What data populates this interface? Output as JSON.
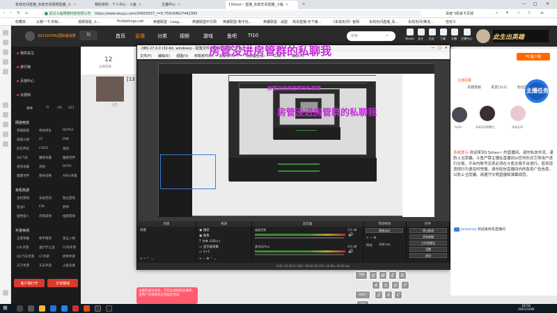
{
  "browser": {
    "tabs": [
      {
        "label": "永劫无间直播_永劫无间视频直播_小"
      },
      {
        "label": "我的资料 - 个人中心 - 斗鱼"
      },
      {
        "label": "主播中心"
      },
      {
        "label": "13shao~ 直播_永劫无间直播_斗鱼"
      }
    ],
    "address_tag": "武汉斗鱼网络科技有限公司",
    "url": "https://www.douyu.com/24655557_r=0.7591946274423​95",
    "right_label": "百度飞机就卡灭掉",
    "bookmarks": [
      "收藏夹",
      "从我一下,你就... ",
      "视频观看_斗...",
      "ProSettings.net",
      "英雄联盟 - Leag...",
      "英雄联盟中文网",
      "英雄联盟-我不玩...",
      "英雄联盟 - 战盟",
      "高清直播-天下第...",
      "《永劫无间》官网",
      "永劫无间直播_永...",
      "永劫无间(推流...",
      "自定义"
    ]
  },
  "douyu": {
    "brand": "2021DOTA2国际邀请赛",
    "nav": [
      "首页",
      "直播",
      "分类",
      "视频",
      "游戏",
      "鱼吧",
      "TI10"
    ],
    "search_placeholder": "搜索",
    "header_right": [
      "Steam",
      "关注",
      "历史",
      "下载",
      "开播",
      "主播中心"
    ],
    "sidebar": {
      "top_items": [
        "我的关注",
        "排行榜",
        "页游中心",
        "云游戏"
      ],
      "tags_row": [
        "赛事",
        "TI",
        "LPL",
        "S11"
      ],
      "section1_head": "网游竞技",
      "section1": [
        "英雄联盟",
        "绝地求生",
        "DOTA2",
        "穿越火线",
        "CF",
        "DNF",
        "炉石传说",
        "CSGO",
        "星际",
        "QQ飞车",
        "魔兽争霸",
        "魔兽世界",
        "星际争霸",
        "其他",
        "DOTA",
        "雷霆世界",
        "使命召唤",
        "APEX英雄"
      ],
      "section2_head": "单机热游",
      "section2": [
        "主机游戏",
        "永劫无间",
        "独立游戏",
        "星战2",
        "FPA",
        "原神",
        "怪物猎人",
        "恐怖游戏",
        "怪兽游戏"
      ],
      "section3_head": "手游休闲",
      "section3": [
        "王者荣耀",
        "和平精英",
        "第五人格",
        "LOL手游",
        "金铲铲之战",
        "COD手游",
        "QQ飞车手游",
        "CF手游",
        "原神手游",
        "天刀手游",
        "天天手游",
        "火影忍者"
      ],
      "btn_client": "客户端打开",
      "btn_share": "分享赚钱"
    },
    "room": {
      "count": "12",
      "count_label": "主播等级",
      "title": "[13",
      "extra_label": "公告"
    },
    "right_panel": {
      "pc_client": "PC客户端",
      "task_badge": "主播任务",
      "tabs": [
        "主播招募",
        "本期贡献",
        "贵宾(212)",
        "粉丝团"
      ],
      "avatars": [
        {
          "name": "tsyku"
        },
        {
          "name": "永劫无间相聚之"
        },
        {
          "name": "永劫无间"
        }
      ],
      "chat_sys_label": "系统提示:",
      "chat_text": "欢迎来到13shao~ 的直播间，请勿私信外流，谨防上当受骗。斗鱼严禁主播在直播间以任何形式引导用户进行交易，平台内账号买卖必须在斗鱼交易平台进行。若发现违规行为请及时举报。请勿轻信直播间内的各类广告信息，以防上当受骗。请遵守文明直播和弹幕规范。",
      "chat_user": "Jackalray",
      "chat_user_msg": "欢迎来到本直播间"
    }
  },
  "obs": {
    "title": "OBS 27.0.0 (32-bit, windows) - 配置文件: 未命名 - 场景: 未命名",
    "menu": [
      "文件(F)",
      "编辑(E)",
      "视图(V)",
      "停靠部件(D)",
      "配置文件(P)",
      "场景集合(S)",
      "工具(T)",
      "帮助(H)"
    ],
    "overlay_big": "房管没进房管群的私聊我",
    "overlay_small": "房管没进房管群的私聊我",
    "docks": [
      "场景",
      "来源",
      "混音器",
      "转场特效",
      "控件"
    ],
    "scene_items": [
      "场景"
    ],
    "sources": [
      "捕捉",
      "图像",
      "文本 (GDI+)",
      "显示器采集",
      "1+1"
    ],
    "mixer": [
      {
        "label": "桌面音频",
        "level": "-3.5 dB"
      },
      {
        "label": "麦克风/Aux",
        "level": "-0.0 dB"
      }
    ],
    "transition": {
      "label": "直接淡出",
      "duration_label": "时长",
      "duration": "300 ms"
    },
    "controls": [
      "停止推流",
      "开始录制",
      "工作室模式",
      "设置",
      "退出"
    ],
    "status": "LIVE: 01:44:11   REC: 00:00:00   CPU: 16.8%, 60.00 fps"
  },
  "keyboard": [
    "TAB",
    "Q",
    "W",
    "E",
    "R",
    "A",
    "S",
    "D",
    "F",
    "SHIFT",
    "Z",
    "X",
    "C",
    "CTRL"
  ],
  "popup": {
    "text": "主播完成任务后，可在此领取粉丝徽章，且用户可领取对应奖励的活动"
  },
  "taskbar": {
    "time": "18:56",
    "date": "2021/10/8"
  }
}
